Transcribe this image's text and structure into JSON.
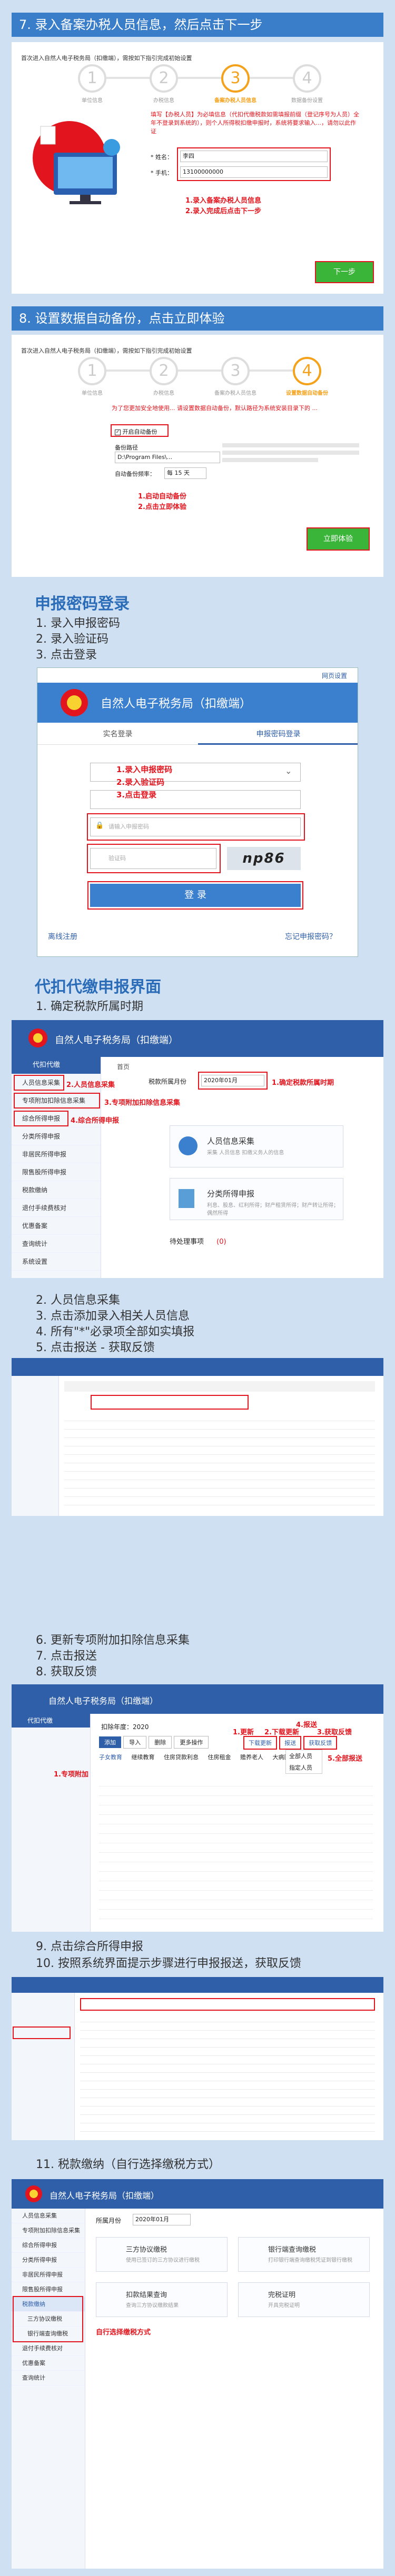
{
  "step7": {
    "title": "7. 录入备案办税人员信息，然后点击下一步",
    "shot_caption": "首次进入自然人电子税务局（扣缴端），需按如下指引完成初始设置",
    "steps": [
      "1",
      "2",
      "3",
      "4"
    ],
    "step_labels": [
      "单位信息",
      "办税信息",
      "备案办税人员信息",
      "数据备份设置"
    ],
    "notice": "填写【办税人员】为必填信息（代扣代缴税款如需填报前缀（登记序号为人员）全年不登录到系统的），则个人所得税扣缴申报时，系统将要求输入...，请勿以此作证",
    "name_label": "* 姓名：",
    "name_value": "李四",
    "phone_label": "* 手机：",
    "phone_value": "13100000000",
    "annot1": "1.录入备案办税人员信息",
    "annot2": "2.录入完成后点击下一步",
    "next_button": "下一步"
  },
  "step8": {
    "title": "8. 设置数据自动备份，点击立即体验",
    "shot_caption": "首次进入自然人电子税务局（扣缴端），需按如下指引完成初始设置",
    "steps": [
      "1",
      "2",
      "3",
      "4"
    ],
    "step_labels": [
      "单位信息",
      "办税信息",
      "备案办税人员信息",
      "设置数据自动备份"
    ],
    "hint": "为了您更加安全地使用... 请设置数据自动备份，默认路径为系统安装目录下的 ...",
    "auto_backup": "开启自动备份",
    "path_label": "备份路径",
    "path_value": "D:\\Program Files\\...",
    "freq_label": "自动备份频率：",
    "freq_value": "每 15 天",
    "annot1": "1.启动自动备份",
    "annot2": "2.点击立即体验",
    "experience_button": "立即体验"
  },
  "login": {
    "title": "申报密码登录",
    "steps": [
      "1. 录入申报密码",
      "2. 录入验证码",
      "3. 点击登录"
    ],
    "top_link": "网页设置",
    "app_title": "自然人电子税务局（扣缴端）",
    "tab_realname": "实名登录",
    "tab_password": "申报密码登录",
    "password_placeholder": "请输入申报密码",
    "captcha_placeholder": "验证码",
    "captcha_code": "np86",
    "annot1": "1.录入申报密码",
    "annot2": "2.录入验证码",
    "annot3": "3.点击登录",
    "login_button": "登 录",
    "offline_register": "离线注册",
    "forgot_password": "忘记申报密码？"
  },
  "withhold": {
    "title": "代扣代缴申报界面",
    "step": "1. 确定税款所属时期",
    "app_title": "自然人电子税务局（扣缴端）",
    "home": "首页",
    "period_label": "税款所属月份",
    "period_value": "2020年01月",
    "annot1": "1.确定税款所属时期",
    "annot2": "2.人员信息采集",
    "annot3": "3.专项附加扣除信息采集",
    "annot4": "4.综合所得申报",
    "side_header": "代扣代缴",
    "side_items": [
      "人员信息采集",
      "专项附加扣除信息采集",
      "综合所得申报",
      "分类所得申报",
      "非居民所得申报",
      "限售股所得申报",
      "税款缴纳",
      "退付手续费核对",
      "优惠备案",
      "查询统计",
      "系统设置"
    ],
    "card1_title": "人员信息采集",
    "card1_sub": "采集 人员信息 扣缴义务人的信息",
    "card2_title": "分类所得申报",
    "card2_sub": "利息、股息、红利所得；财产租赁所得；财产转让所得；偶然所得",
    "todo_label": "待处理事项",
    "todo_count": "(0)"
  },
  "step2to5": {
    "lines": [
      "2. 人员信息采集",
      "3. 点击添加录入相关人员信息",
      "4. 所有\"*\"必录项全部如实填报",
      "5. 点击报送 - 获取反馈"
    ]
  },
  "step6to8": {
    "lines": [
      "6. 更新专项附加扣除信息采集",
      "7. 点击报送",
      "8. 获取反馈"
    ],
    "annot1": "1.更新",
    "annot2": "2.下载更新",
    "annot3": "3.获取反馈",
    "annot4": "4.报送",
    "year_label": "扣除年度：2020",
    "side_header": "代扣代缴",
    "buttons": [
      "添加",
      "导入",
      "删除",
      "更多操作"
    ],
    "tabs": [
      "子女教育",
      "继续教育",
      "住房贷款利息",
      "住房租金",
      "赡养老人",
      "大病医疗"
    ],
    "right_buttons": [
      "下载更新",
      "报送",
      "获取反馈"
    ],
    "mini_menu": [
      "全部人员",
      "指定人员"
    ],
    "annot5": "5.全部报送",
    "annot6": "1.专项附加"
  },
  "step9to10": {
    "lines": [
      "9. 点击综合所得申报",
      "10. 按照系统界面提示步骤进行申报报送，获取反馈"
    ]
  },
  "step11": {
    "title": "11. 税款缴纳（自行选择缴税方式）",
    "app_title": "自然人电子税务局（扣缴端）",
    "period_label": "所属月份",
    "period_value": "2020年01月",
    "side_items": [
      "人员信息采集",
      "专项附加扣除信息采集",
      "综合所得申报",
      "分类所得申报",
      "非居民所得申报",
      "限售股所得申报",
      "税款缴纳",
      "三方协议缴税",
      "银行端查询缴税",
      "退付手续费核对",
      "优惠备案",
      "查询统计"
    ],
    "card1": "三方协议缴税",
    "card1_sub": "使用已签订的三方协议进行缴税",
    "card2": "银行端查询缴税",
    "card2_sub": "打印银行端查询缴税凭证到银行缴税",
    "card3": "扣款结果查询",
    "card3_sub": "查询三方协议缴款结果",
    "card4": "完税证明",
    "card4_sub": "开具完税证明",
    "annot": "自行选择缴税方式"
  },
  "colors": {
    "header_bg": "#3a7ec9",
    "annot_red": "#e2141d",
    "step_orange": "#f4a21c",
    "button_green": "#3ab53a",
    "app_blue": "#2f5fa8"
  }
}
